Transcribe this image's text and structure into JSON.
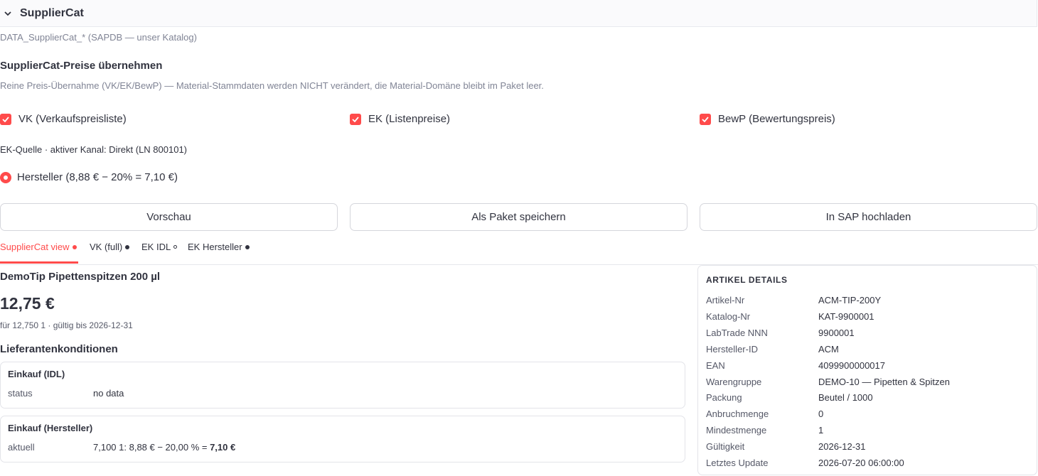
{
  "expander": {
    "title": "SupplierCat"
  },
  "source_caption": "DATA_SupplierCat_* (SAPDB — unser Katalog)",
  "section": {
    "title": "SupplierCat-Preise übernehmen",
    "description": "Reine Preis-Übernahme (VK/EK/BewP) — Material-Stammdaten werden NICHT verändert, die Material-Domäne bleibt im Paket leer."
  },
  "checkboxes": [
    {
      "label": "VK (Verkaufspreisliste)",
      "checked": true
    },
    {
      "label": "EK (Listenpreise)",
      "checked": true
    },
    {
      "label": "BewP (Bewertungspreis)",
      "checked": true
    }
  ],
  "ek_source": "EK-Quelle · aktiver Kanal: Direkt (LN 800101)",
  "radio": {
    "label": "Hersteller (8,88 € − 20% = 7,10 €)",
    "selected": true
  },
  "buttons": {
    "preview": "Vorschau",
    "save": "Als Paket speichern",
    "upload": "In SAP hochladen"
  },
  "tabs": [
    {
      "label": "SupplierCat view",
      "dot": "filled-red",
      "active": true
    },
    {
      "label": "VK (full)",
      "dot": "filled"
    },
    {
      "label": "EK IDL",
      "dot": "hollow"
    },
    {
      "label": "EK Hersteller",
      "dot": "filled"
    }
  ],
  "product": {
    "name": "DemoTip Pipettenspitzen 200 µl",
    "price": "12,75 €",
    "price_note": "für 12,750 1 · gültig bis 2026-12-31"
  },
  "conditions": {
    "title": "Lieferantenkonditionen",
    "idl": {
      "title": "Einkauf (IDL)",
      "key": "status",
      "value": "no data"
    },
    "hersteller": {
      "title": "Einkauf (Hersteller)",
      "key": "aktuell",
      "value_prefix": "7,100 1: 8,88 € − 20,00 % = ",
      "value_bold": "7,10 €"
    }
  },
  "details": {
    "title": "ARTIKEL DETAILS",
    "rows": [
      {
        "k": "Artikel-Nr",
        "v": "ACM-TIP-200Y"
      },
      {
        "k": "Katalog-Nr",
        "v": "KAT-9900001"
      },
      {
        "k": "LabTrade NNN",
        "v": "9900001"
      },
      {
        "k": "Hersteller-ID",
        "v": "ACM"
      },
      {
        "k": "EAN",
        "v": "4099900000017"
      },
      {
        "k": "Warengruppe",
        "v": "DEMO-10 — Pipetten & Spitzen"
      },
      {
        "k": "Packung",
        "v": "Beutel / 1000"
      },
      {
        "k": "Anbruchmenge",
        "v": "0"
      },
      {
        "k": "Mindestmenge",
        "v": "1"
      },
      {
        "k": "Gültigkeit",
        "v": "2026-12-31"
      },
      {
        "k": "Letztes Update",
        "v": "2026-07-20 06:00:00"
      }
    ]
  },
  "colors": {
    "accent": "#ff4b4b",
    "text": "#31333f",
    "muted": "#808495"
  }
}
